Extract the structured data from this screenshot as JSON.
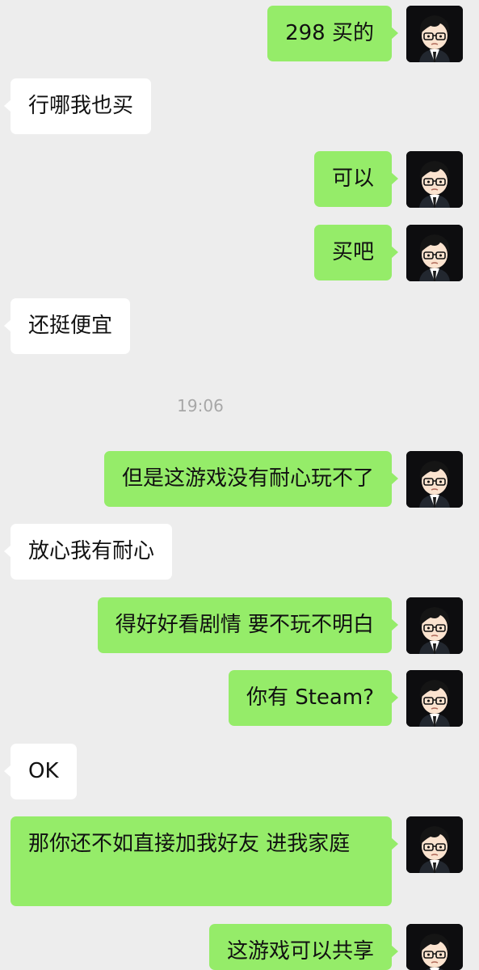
{
  "chat": {
    "timestamp": "19:06",
    "avatar_icon": "cartoon-man-with-glasses",
    "colors": {
      "background": "#ededed",
      "outgoing_bubble": "#95ec69",
      "incoming_bubble": "#ffffff",
      "timestamp": "#a7a7a7"
    },
    "messages": [
      {
        "sender": "self",
        "text": "298 买的"
      },
      {
        "sender": "other",
        "text": "行哪我也买"
      },
      {
        "sender": "self",
        "text": "可以"
      },
      {
        "sender": "self",
        "text": "买吧"
      },
      {
        "sender": "other",
        "text": "还挺便宜"
      },
      {
        "sender": "self",
        "text": "但是这游戏没有耐心玩不了"
      },
      {
        "sender": "other",
        "text": "放心我有耐心"
      },
      {
        "sender": "self",
        "text": "得好好看剧情 要不玩不明白"
      },
      {
        "sender": "self",
        "text": "你有 Steam?"
      },
      {
        "sender": "other",
        "text": "OK"
      },
      {
        "sender": "self",
        "text": "那你还不如直接加我好友 进我家庭"
      },
      {
        "sender": "self",
        "text": "这游戏可以共享"
      }
    ]
  }
}
